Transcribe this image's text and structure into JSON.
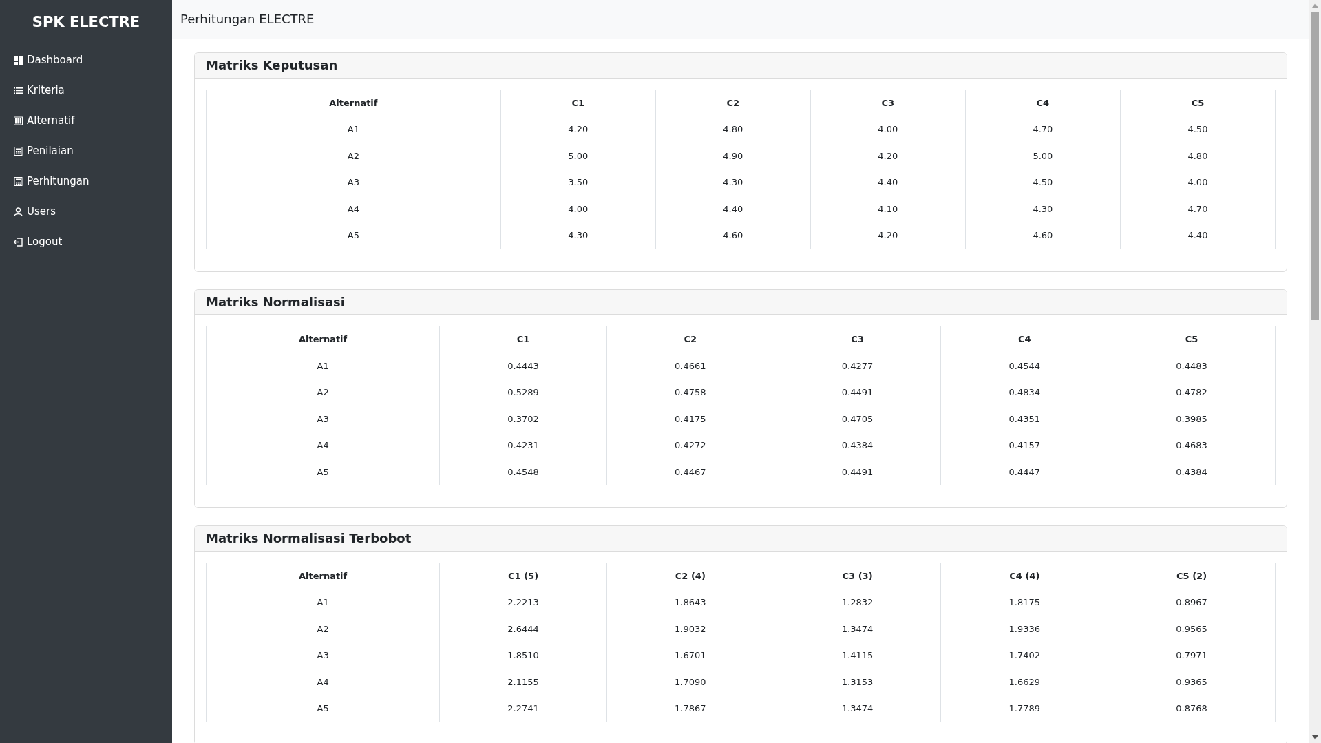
{
  "sidebar": {
    "brand": "SPK ELECTRE",
    "items": [
      {
        "label": "Dashboard"
      },
      {
        "label": "Kriteria"
      },
      {
        "label": "Alternatif"
      },
      {
        "label": "Penilaian"
      },
      {
        "label": "Perhitungan"
      },
      {
        "label": "Users"
      },
      {
        "label": "Logout"
      }
    ]
  },
  "header": {
    "title": "Perhitungan ELECTRE"
  },
  "cards": [
    {
      "title": "Matriks Keputusan",
      "columns": [
        "Alternatif",
        "C1",
        "C2",
        "C3",
        "C4",
        "C5"
      ],
      "rows": [
        [
          "A1",
          "4.20",
          "4.80",
          "4.00",
          "4.70",
          "4.50"
        ],
        [
          "A2",
          "5.00",
          "4.90",
          "4.20",
          "5.00",
          "4.80"
        ],
        [
          "A3",
          "3.50",
          "4.30",
          "4.40",
          "4.50",
          "4.00"
        ],
        [
          "A4",
          "4.00",
          "4.40",
          "4.10",
          "4.30",
          "4.70"
        ],
        [
          "A5",
          "4.30",
          "4.60",
          "4.20",
          "4.60",
          "4.40"
        ]
      ]
    },
    {
      "title": "Matriks Normalisasi",
      "columns": [
        "Alternatif",
        "C1",
        "C2",
        "C3",
        "C4",
        "C5"
      ],
      "rows": [
        [
          "A1",
          "0.4443",
          "0.4661",
          "0.4277",
          "0.4544",
          "0.4483"
        ],
        [
          "A2",
          "0.5289",
          "0.4758",
          "0.4491",
          "0.4834",
          "0.4782"
        ],
        [
          "A3",
          "0.3702",
          "0.4175",
          "0.4705",
          "0.4351",
          "0.3985"
        ],
        [
          "A4",
          "0.4231",
          "0.4272",
          "0.4384",
          "0.4157",
          "0.4683"
        ],
        [
          "A5",
          "0.4548",
          "0.4467",
          "0.4491",
          "0.4447",
          "0.4384"
        ]
      ]
    },
    {
      "title": "Matriks Normalisasi Terbobot",
      "columns": [
        "Alternatif",
        "C1 (5)",
        "C2 (4)",
        "C3 (3)",
        "C4 (4)",
        "C5 (2)"
      ],
      "rows": [
        [
          "A1",
          "2.2213",
          "1.8643",
          "1.2832",
          "1.8175",
          "0.8967"
        ],
        [
          "A2",
          "2.6444",
          "1.9032",
          "1.3474",
          "1.9336",
          "0.9565"
        ],
        [
          "A3",
          "1.8510",
          "1.6701",
          "1.4115",
          "1.7402",
          "0.7971"
        ],
        [
          "A4",
          "2.1155",
          "1.7090",
          "1.3153",
          "1.6629",
          "0.9365"
        ],
        [
          "A5",
          "2.2741",
          "1.7867",
          "1.3474",
          "1.7789",
          "0.8768"
        ]
      ]
    }
  ]
}
